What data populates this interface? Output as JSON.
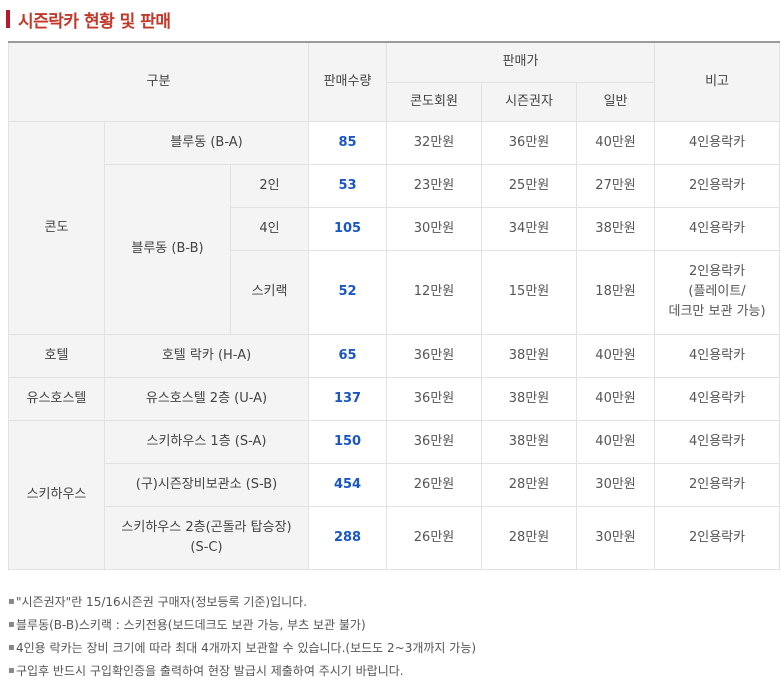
{
  "title": "시즌락카 현황 및 판매",
  "header": {
    "category": "구분",
    "quantity": "판매수량",
    "price": "판매가",
    "condo_member": "콘도회원",
    "season_pass": "시즌권자",
    "general": "일반",
    "remarks": "비고"
  },
  "groups": {
    "condo": "콘도",
    "hotel": "호텔",
    "youth_hostel": "유스호스텔",
    "ski_house": "스키하우스"
  },
  "rows": [
    {
      "name": "블루동 (B-A)",
      "qty": "85",
      "condo": "32만원",
      "season": "36만원",
      "general": "40만원",
      "note": "4인용락카"
    },
    {
      "name": "블루동 (B-B)",
      "sub": "2인",
      "qty": "53",
      "condo": "23만원",
      "season": "25만원",
      "general": "27만원",
      "note": "2인용락카"
    },
    {
      "sub": "4인",
      "qty": "105",
      "condo": "30만원",
      "season": "34만원",
      "general": "38만원",
      "note": "4인용락카"
    },
    {
      "sub": "스키랙",
      "qty": "52",
      "condo": "12만원",
      "season": "15만원",
      "general": "18만원",
      "note": "2인용락카\n(플레이트/\n데크만 보관 가능)"
    },
    {
      "name": "호텔 락카 (H-A)",
      "qty": "65",
      "condo": "36만원",
      "season": "38만원",
      "general": "40만원",
      "note": "4인용락카"
    },
    {
      "name": "유스호스텔 2층 (U-A)",
      "qty": "137",
      "condo": "36만원",
      "season": "38만원",
      "general": "40만원",
      "note": "4인용락카"
    },
    {
      "name": "스키하우스 1층 (S-A)",
      "qty": "150",
      "condo": "36만원",
      "season": "38만원",
      "general": "40만원",
      "note": "4인용락카"
    },
    {
      "name": "(구)시즌장비보관소 (S-B)",
      "qty": "454",
      "condo": "26만원",
      "season": "28만원",
      "general": "30만원",
      "note": "2인용락카"
    },
    {
      "name": "스키하우스 2층(곤돌라 탑승장)\n(S-C)",
      "qty": "288",
      "condo": "26만원",
      "season": "28만원",
      "general": "30만원",
      "note": "2인용락카"
    }
  ],
  "notes": [
    "\"시즌권자\"란 15/16시즌권 구매자(정보등록 기준)입니다.",
    "블루동(B-B)스키랙 : 스키전용(보드데크도 보관 가능, 부츠 보관 불가)",
    "4인용 락카는 장비 크기에 따라 최대 4개까지 보관할 수 있습니다.(보드도 2~3개까지 가능)",
    "구입후 반드시 구입확인증을 출력하여 현장 발급시 제출하여 주시기 바랍니다."
  ]
}
